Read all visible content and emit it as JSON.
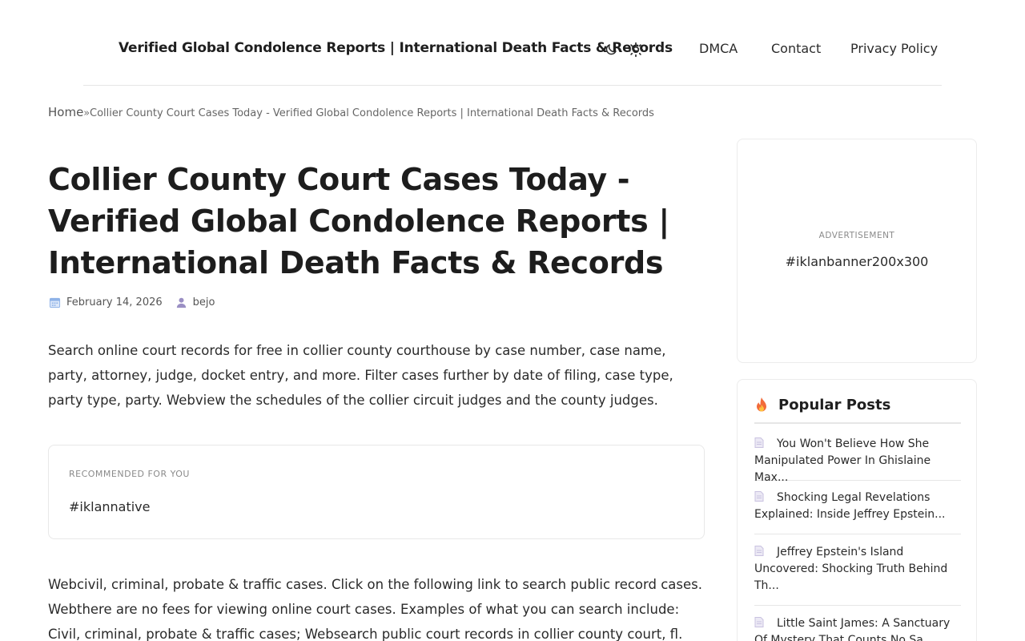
{
  "header": {
    "site_title": "Verified Global Condolence Reports | International Death Facts & Records",
    "nav": [
      "DMCA",
      "Contact",
      "Privacy Policy"
    ],
    "icons": {
      "dark_mode": "moon-icon",
      "light_mode": "sun-icon"
    }
  },
  "breadcrumb": {
    "home": "Home",
    "separator": "»",
    "current": "Collier County Court Cases Today - Verified Global Condolence Reports | International Death Facts & Records"
  },
  "post": {
    "title": "Collier County Court Cases Today - Verified Global Condolence Reports | International Death Facts & Records",
    "date": "February 14, 2026",
    "author": "bejo",
    "paragraph1": "Search online court records for free in collier county courthouse by case number, case name, party, attorney, judge, docket entry, and more. Filter cases further by date of filing, case type, party type, party. Webview the schedules of the collier circuit judges and the county judges.",
    "paragraph2": "Webcivil, criminal, probate & traffic cases. Click on the following link to search public record cases. Webthere are no fees for viewing online court cases. Examples of what you can search include: Civil, criminal, probate & traffic cases; Websearch public court records in collier county court, fl. Lookup court"
  },
  "native_ad": {
    "label": "RECOMMENDED FOR YOU",
    "text": "#iklannative"
  },
  "sidebar": {
    "ad": {
      "label": "ADVERTISEMENT",
      "text": "#iklanbanner200x300"
    },
    "popular": {
      "title": "Popular Posts",
      "items": [
        "You Won't Believe How She Manipulated Power In Ghislaine Max...",
        "Shocking Legal Revelations Explained: Inside Jeffrey Epstein...",
        "Jeffrey Epstein's Island Uncovered: Shocking Truth Behind Th...",
        "Little Saint James: A Sanctuary Of Mystery That Counts No Sa..."
      ]
    }
  },
  "colors": {
    "text": "#1a1a1a",
    "border": "#e6e6e6",
    "calendar_icon": "#8fb3e8",
    "user_icon": "#9b8fc4",
    "flame_icon": "#f26b3a",
    "doc_icon": "#c9c2e0"
  }
}
